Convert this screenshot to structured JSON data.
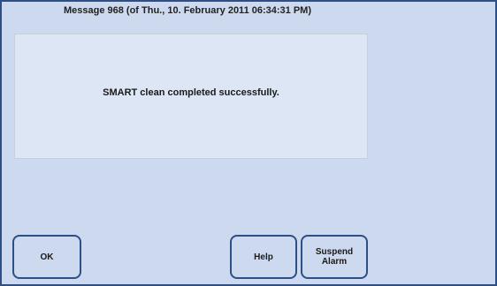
{
  "dialog": {
    "header": "Message 968 (of Thu., 10. February 2011 06:34:31 PM)",
    "message": "SMART clean completed successfully.",
    "buttons": {
      "ok": "OK",
      "help": "Help",
      "suspend_alarm": "Suspend\nAlarm"
    }
  }
}
